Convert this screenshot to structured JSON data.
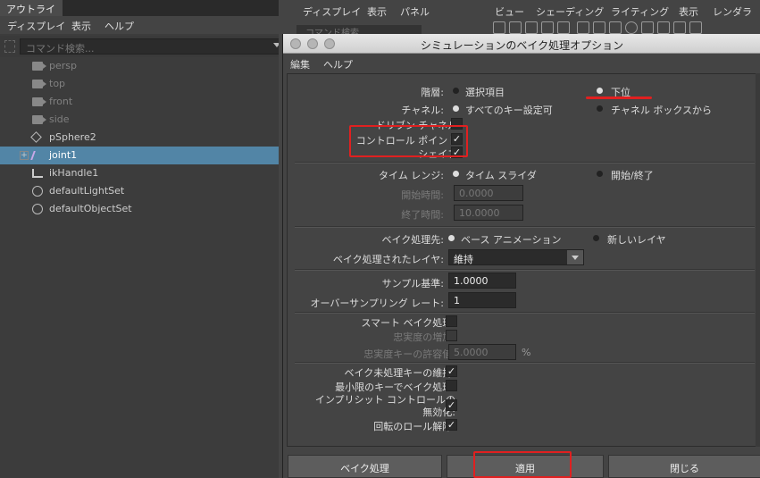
{
  "outliner": {
    "tab": "アウトライナ",
    "menu": [
      "ディスプレイ",
      "表示",
      "ヘルプ"
    ],
    "search_placeholder": "コマンド検索...",
    "items": [
      {
        "label": "persp",
        "icon": "camera-icon"
      },
      {
        "label": "top",
        "icon": "camera-icon"
      },
      {
        "label": "front",
        "icon": "camera-icon"
      },
      {
        "label": "side",
        "icon": "camera-icon"
      },
      {
        "label": "pSphere2",
        "icon": "mesh-icon"
      },
      {
        "label": "joint1",
        "icon": "joint-icon"
      },
      {
        "label": "ikHandle1",
        "icon": "ik-handle-icon"
      },
      {
        "label": "defaultLightSet",
        "icon": "set-icon"
      },
      {
        "label": "defaultObjectSet",
        "icon": "set-icon"
      }
    ]
  },
  "viewport": {
    "menu_left": [
      "ディスプレイ",
      "表示",
      "パネル"
    ],
    "menu_right": [
      "ビュー",
      "シェーディング",
      "ライティング",
      "表示",
      "レンダラ"
    ],
    "command_search": "コマンド検索"
  },
  "dialog": {
    "title": "シミュレーションのベイク処理オプション",
    "menu": [
      "編集",
      "ヘルプ"
    ],
    "hierarchy": {
      "label": "階層:",
      "opt1": "選択項目",
      "opt2": "下位",
      "selected": "下位"
    },
    "channel": {
      "label": "チャネル:",
      "opt1": "すべてのキー設定可",
      "opt2": "チャネル ボックスから",
      "selected": "すべてのキー設定可"
    },
    "driven_channel": {
      "label": "ドリブン チャネル:",
      "checked": false
    },
    "control_points": {
      "label": "コントロール ポイント:",
      "checked": true
    },
    "shapes": {
      "label": "シェイプ:",
      "checked": true
    },
    "time_range": {
      "label": "タイム レンジ:",
      "opt1": "タイム スライダ",
      "opt2": "開始/終了",
      "selected": "タイム スライダ"
    },
    "start_time": {
      "label": "開始時間:",
      "value": "0.0000"
    },
    "end_time": {
      "label": "終了時間:",
      "value": "10.0000"
    },
    "bake_to": {
      "label": "ベイク処理先:",
      "opt1": "ベース アニメーション",
      "opt2": "新しいレイヤ",
      "selected": "ベース アニメーション"
    },
    "baked_layers": {
      "label": "ベイク処理されたレイヤ:",
      "value": "維持"
    },
    "sample_by": {
      "label": "サンプル基準:",
      "value": "1.0000"
    },
    "oversampling": {
      "label": "オーバーサンプリング レート:",
      "value": "1"
    },
    "smart_bake": {
      "label": "スマート ベイク処理:",
      "checked": false
    },
    "increase_fidelity": {
      "label": "忠実度の増加:",
      "checked": false
    },
    "fidelity_keys": {
      "label": "忠実度キーの許容値:",
      "value": "5.0000",
      "unit": "%"
    },
    "keep_unbaked": {
      "label": "ベイク未処理キーの維持:",
      "checked": true
    },
    "sparse_curve": {
      "label": "最小限のキーでベイク処理:",
      "checked": false
    },
    "disable_implicit": {
      "label1": "インプリシット コントロールの",
      "label2": "無効化:",
      "checked": true
    },
    "unroll_rotation": {
      "label": "回転のロール解除:",
      "checked": true
    },
    "buttons": {
      "bake": "ベイク処理",
      "apply": "適用",
      "close": "閉じる"
    }
  },
  "check_mark": "✓",
  "colors": {
    "selection": "#5285a6",
    "annotation": "#e02020"
  }
}
